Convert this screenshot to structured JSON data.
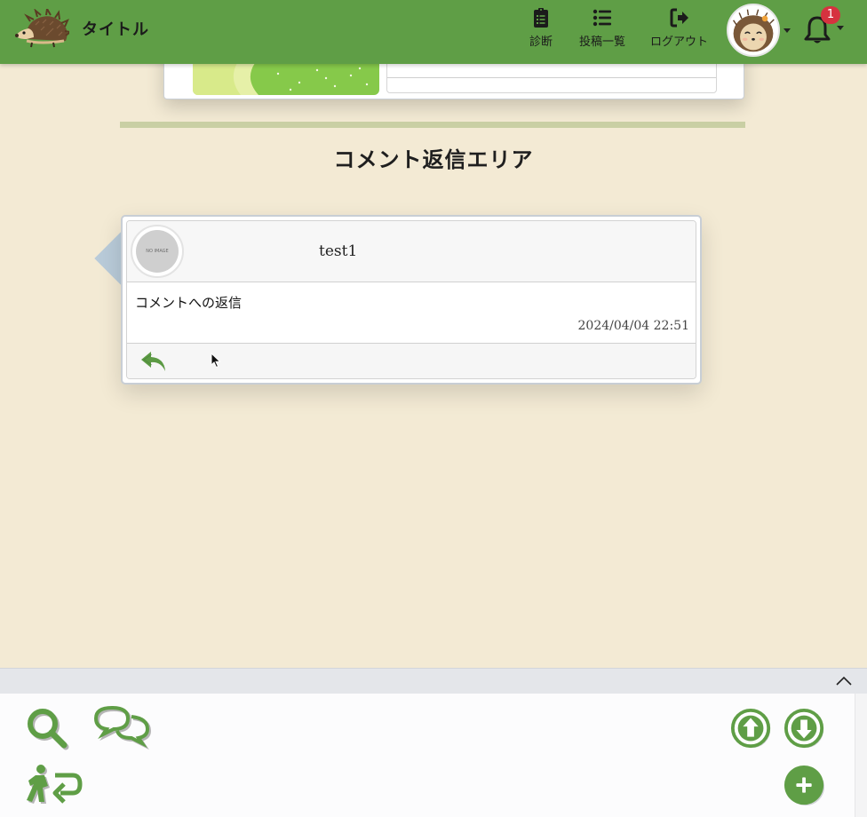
{
  "header": {
    "title": "タイトル",
    "nav": [
      {
        "label": "診断",
        "icon": "clipboard-list-icon"
      },
      {
        "label": "投稿一覧",
        "icon": "list-icon"
      },
      {
        "label": "ログアウト",
        "icon": "logout-icon"
      }
    ],
    "notification_count": "1",
    "colors": {
      "header_bg": "#5f9e46",
      "badge": "#d6323f"
    }
  },
  "section": {
    "title": "コメント返信エリア"
  },
  "comment": {
    "avatar_text": "NO IMAGE",
    "username": "test1",
    "text": "コメントへの返信",
    "timestamp": "2024/04/04 22:51",
    "reply_icon": "reply-icon"
  },
  "toolbar": {
    "icons": [
      "search-icon",
      "comments-icon",
      "walk-back-icon",
      "arrow-up-circle-icon",
      "arrow-down-circle-icon",
      "plus-circle-icon"
    ],
    "accent": "#5f9e46"
  },
  "page": {
    "background": "#f3ead4"
  }
}
